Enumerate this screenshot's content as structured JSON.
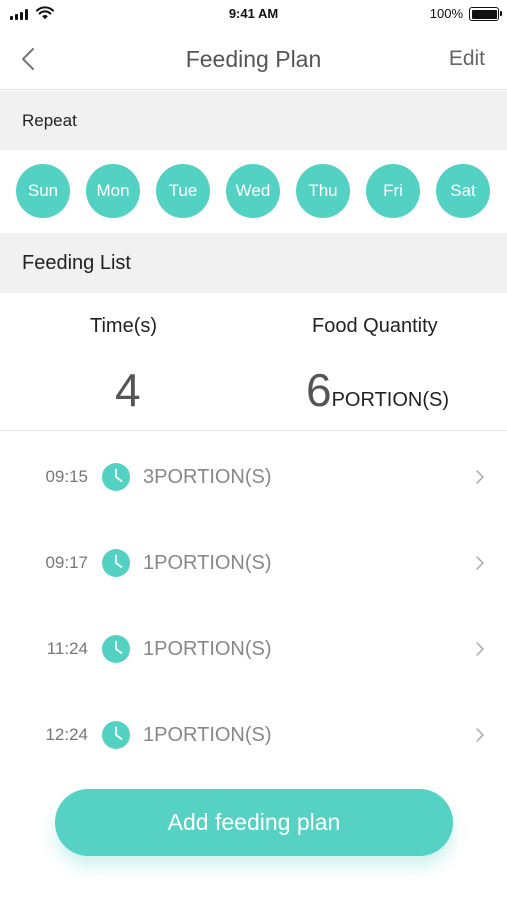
{
  "status_bar": {
    "time": "9:41 AM",
    "battery_percent": "100%",
    "battery_level": 1.0,
    "icons": [
      "signal-icon",
      "wifi-icon",
      "battery-icon"
    ]
  },
  "nav": {
    "title": "Feeding Plan",
    "edit_label": "Edit",
    "back_icon": "chevron-left-icon"
  },
  "repeat": {
    "header": "Repeat",
    "days": [
      "Sun",
      "Mon",
      "Tue",
      "Wed",
      "Thu",
      "Fri",
      "Sat"
    ]
  },
  "feeding_list": {
    "header": "Feeding List",
    "times_label": "Time(s)",
    "times_value": "4",
    "quantity_label": "Food Quantity",
    "quantity_value": "6",
    "quantity_unit": "PORTION(S)",
    "items": [
      {
        "time": "09:15",
        "portion": "3PORTION(S)"
      },
      {
        "time": "09:17",
        "portion": "1PORTION(S)"
      },
      {
        "time": "11:24",
        "portion": "1PORTION(S)"
      },
      {
        "time": "12:24",
        "portion": "1PORTION(S)"
      }
    ]
  },
  "add_button_label": "Add feeding plan",
  "colors": {
    "accent": "#53d1c3",
    "section_background": "#f1f1f1",
    "muted_text": "#888888"
  }
}
